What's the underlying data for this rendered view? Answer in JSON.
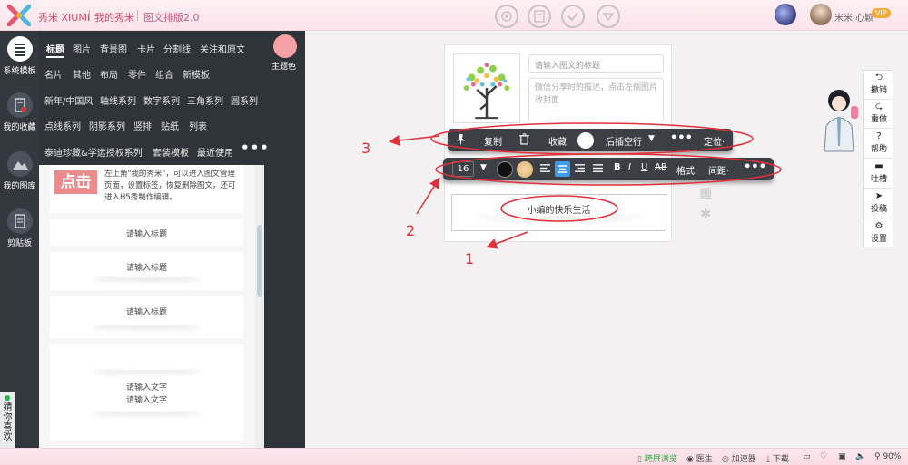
{
  "topbar": {
    "brand": "秀米 XIUMI",
    "my_xiumi": "我的秀米",
    "version": "图文排版2.0",
    "user_name": "米米·心颖",
    "vip_label": "VIP"
  },
  "rail": {
    "items": [
      {
        "label": "系统模板",
        "icon": "list-icon"
      },
      {
        "label": "我的收藏",
        "icon": "bookmark-icon"
      },
      {
        "label": "我的图库",
        "icon": "mountain-image-icon"
      },
      {
        "label": "剪贴板",
        "icon": "clipboard-icon"
      }
    ],
    "guess_label": "猜你喜欢"
  },
  "panel": {
    "theme_label": "主题色",
    "theme_color": "#f4a0a4",
    "categories_row1": [
      "标题",
      "图片",
      "背景图",
      "卡片",
      "分割线",
      "关注和原文"
    ],
    "categories_row2": [
      "名片",
      "其他",
      "布局",
      "零件",
      "组合",
      "新模板"
    ],
    "categories_row3": [
      "新年/中国风",
      "轴线系列",
      "数字系列",
      "三角系列",
      "圆系列"
    ],
    "categories_row4": [
      "点线系列",
      "阴影系列",
      "竖排",
      "贴纸",
      "列表"
    ],
    "categories_row5": [
      "泰迪珍藏&学运授权系列",
      "套装模板",
      "最近使用"
    ],
    "more": "•••"
  },
  "templates": {
    "intro_badge": "点击",
    "intro_text": "左上角\"我的秀米\"，可以进入图文管理页面，设置标签，恢复删除图文，还可进入H5秀制作编辑。",
    "title_placeholder_1": "请输入标题",
    "title_placeholder_2": "请输入标题",
    "title_placeholder_3": "请输入标题",
    "text_placeholder_1": "请输入文字",
    "text_placeholder_2": "请输入文字"
  },
  "canvas": {
    "title_placeholder": "请输入图文的标题",
    "desc_placeholder": "微信分享时的描述，点击左侧图片改封面",
    "text_content": "小编的快乐生活"
  },
  "toolbar_block": {
    "copy": "复制",
    "favorite": "收藏",
    "insert_after": "后插空行",
    "more": "•••",
    "position": "定位·"
  },
  "toolbar_text": {
    "font_size": "16",
    "bold": "B",
    "italic": "I",
    "underline": "U",
    "strike": "AB",
    "format": "格式",
    "spacing": "间距·",
    "more": "•••"
  },
  "right_tools": [
    "撤销",
    "重做",
    "帮助",
    "吐槽",
    "投稿",
    "设置"
  ],
  "annotations": [
    "1",
    "2",
    "3"
  ],
  "bottom": {
    "cross_screen": "跨屏浏览",
    "tool1": "医生",
    "tool2": "加速器",
    "download": "下载",
    "zoom": "90%"
  },
  "colors": {
    "accent": "#e0303a",
    "panel_bg": "#2f343b",
    "toolbar_bg": "#3c4046",
    "active_align": "#3d9cf0"
  }
}
